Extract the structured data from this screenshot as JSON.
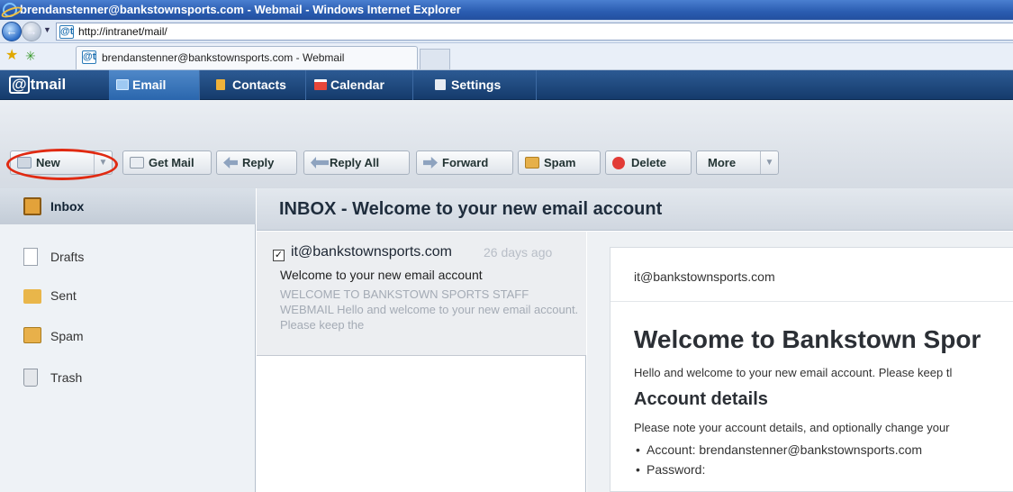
{
  "window": {
    "title": "brendanstenner@bankstownsports.com - Webmail - Windows Internet Explorer"
  },
  "browser": {
    "address": "http://intranet/mail/",
    "tab_title": "brendanstenner@bankstownsports.com - Webmail",
    "favicon_text": "@t"
  },
  "app": {
    "brand_mark": "@",
    "brand_text": "tmail",
    "nav": [
      {
        "label": "Email",
        "active": true,
        "color": "#9ec9f2"
      },
      {
        "label": "Contacts",
        "active": false,
        "color": "#f0b23a"
      },
      {
        "label": "Calendar",
        "active": false,
        "color": "#e7473a"
      },
      {
        "label": "Settings",
        "active": false,
        "color": "#e8ecf2"
      }
    ]
  },
  "toolbar": {
    "new": "New",
    "get_mail": "Get Mail",
    "reply": "Reply",
    "reply_all": "Reply All",
    "forward": "Forward",
    "spam": "Spam",
    "delete": "Delete",
    "more": "More",
    "dropdown_glyph": "▼",
    "highlight_color": "#e02a12"
  },
  "folders": [
    {
      "label": "Inbox",
      "active": true,
      "icon": "inbox-icon"
    },
    {
      "label": "Drafts",
      "active": false,
      "icon": "drafts-icon"
    },
    {
      "label": "Sent",
      "active": false,
      "icon": "sent-icon"
    },
    {
      "label": "Spam",
      "active": false,
      "icon": "spam-icon"
    },
    {
      "label": "Trash",
      "active": false,
      "icon": "trash-icon"
    }
  ],
  "inbox": {
    "header": "INBOX - Welcome to your new email account",
    "messages": [
      {
        "checked": true,
        "from": "it@bankstownsports.com",
        "date": "26 days ago",
        "subject": "Welcome to your new email account",
        "preview": "WELCOME TO BANKSTOWN SPORTS STAFF WEBMAIL Hello and welcome to your new email account. Please keep the"
      }
    ]
  },
  "preview": {
    "from": "it@bankstownsports.com",
    "title": "Welcome to Bankstown Spor",
    "intro": "Hello and welcome to your new email account. Please keep tl",
    "section_heading": "Account details",
    "note": "Please note your account details, and optionally change your",
    "items": [
      "Account: brendanstenner@bankstownsports.com",
      "Password:"
    ]
  }
}
